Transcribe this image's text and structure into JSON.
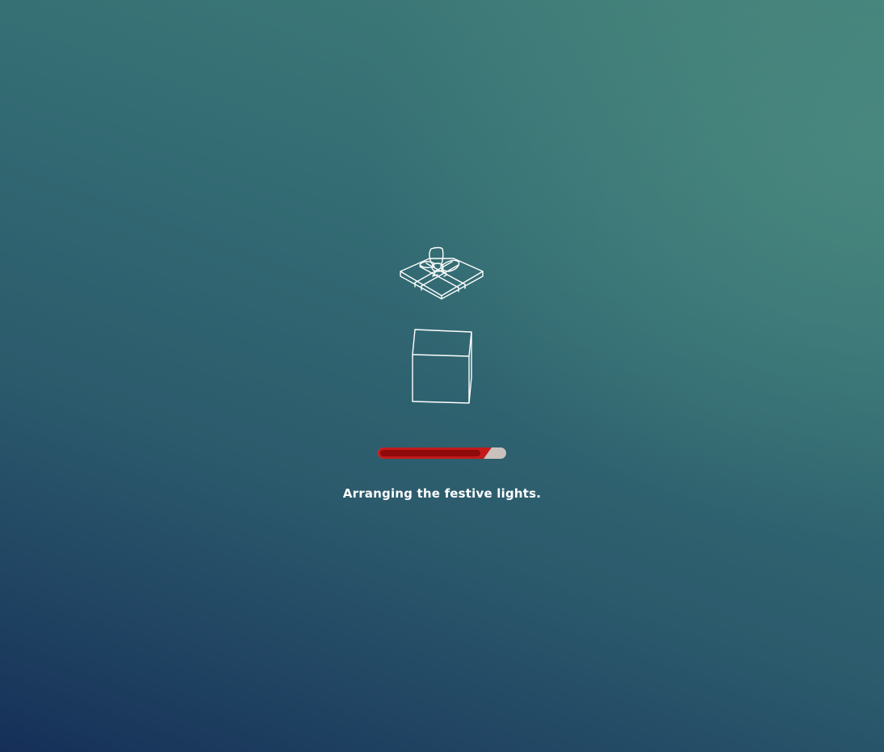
{
  "loader": {
    "status_text": "Arranging the festive lights.",
    "progress_percent": 82,
    "icons": {
      "lid": "gift-lid-with-bow-icon",
      "box": "gift-box-icon"
    }
  },
  "colors": {
    "background_top": "#438079",
    "background_bottom": "#152f58",
    "progress_fill": "#c41a1a",
    "progress_track": "#c9c1bc",
    "icon_stroke": "#ffffff",
    "text": "#ffffff"
  }
}
